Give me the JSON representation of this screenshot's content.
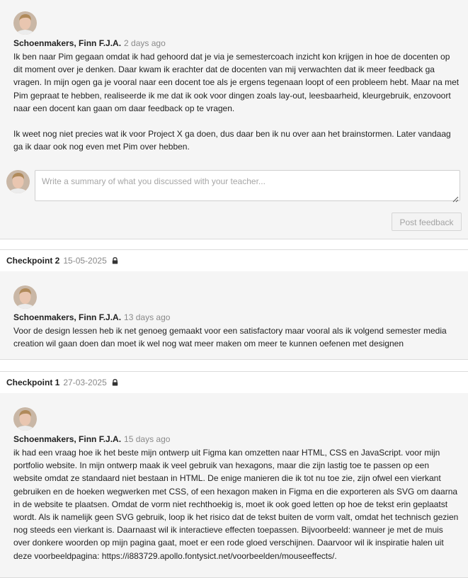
{
  "current": {
    "author": "Schoenmakers, Finn F.J.A.",
    "time": "2 days ago",
    "text": "Ik ben naar Pim gegaan omdat ik had gehoord dat je via je semestercoach inzicht kon krijgen in hoe de docenten op dit moment over je denken. Daar kwam ik erachter dat de docenten van mij verwachten dat ik meer feedback ga vragen. In mijn ogen ga je vooral naar een docent toe als je ergens tegenaan loopt of een probleem hebt. Maar na met Pim gepraat te hebben, realiseerde ik me dat ik ook voor dingen zoals lay-out, leesbaarheid, kleurgebruik, enzovoort naar een docent kan gaan om daar feedback op te vragen.\n\nIk weet nog niet precies wat ik voor Project X ga doen, dus daar ben ik nu over aan het brainstormen. Later vandaag ga ik daar ook nog even met Pim over hebben."
  },
  "composer": {
    "placeholder": "Write a summary of what you discussed with your teacher...",
    "post_label": "Post feedback"
  },
  "checkpoints": [
    {
      "title": "Checkpoint 2",
      "date": "15-05-2025",
      "author": "Schoenmakers, Finn F.J.A.",
      "time": "13 days ago",
      "text": "Voor de design lessen heb ik net genoeg gemaakt voor een satisfactory maar vooral als ik volgend semester media creation wil gaan doen dan moet ik wel nog wat meer maken om meer te kunnen oefenen met designen"
    },
    {
      "title": "Checkpoint 1",
      "date": "27-03-2025",
      "author": "Schoenmakers, Finn F.J.A.",
      "time": "15 days ago",
      "text": "ik had een vraag hoe ik het beste mijn ontwerp uit Figma kan omzetten naar HTML, CSS en JavaScript. voor mijn portfolio website. In mijn ontwerp maak ik veel gebruik van hexagons, maar die zijn lastig toe te passen op een website omdat ze standaard niet bestaan in HTML. De enige manieren die ik tot nu toe zie, zijn ofwel een vierkant gebruiken en de hoeken wegwerken met CSS, of een hexagon maken in Figma en die exporteren als SVG om daarna in de website te plaatsen. Omdat de vorm niet rechthoekig is, moet ik ook goed letten op hoe de tekst erin geplaatst wordt. Als ik namelijk geen SVG gebruik, loop ik het risico dat de tekst buiten de vorm valt, omdat het technisch gezien nog steeds een vierkant is. Daarnaast wil ik interactieve effecten toepassen. Bijvoorbeeld: wanneer je met de muis over donkere woorden op mijn pagina gaat, moet er een rode gloed verschijnen. Daarvoor wil ik inspiratie halen uit deze voorbeeldpagina: https://i883729.apollo.fontysict.net/voorbeelden/mouseeffects/."
    }
  ],
  "icons": {
    "lock": "lock-icon",
    "avatar": "user-avatar"
  },
  "colors": {
    "muted": "#8a8a8a",
    "panel": "#f5f5f5",
    "border": "#dcdcdc"
  }
}
